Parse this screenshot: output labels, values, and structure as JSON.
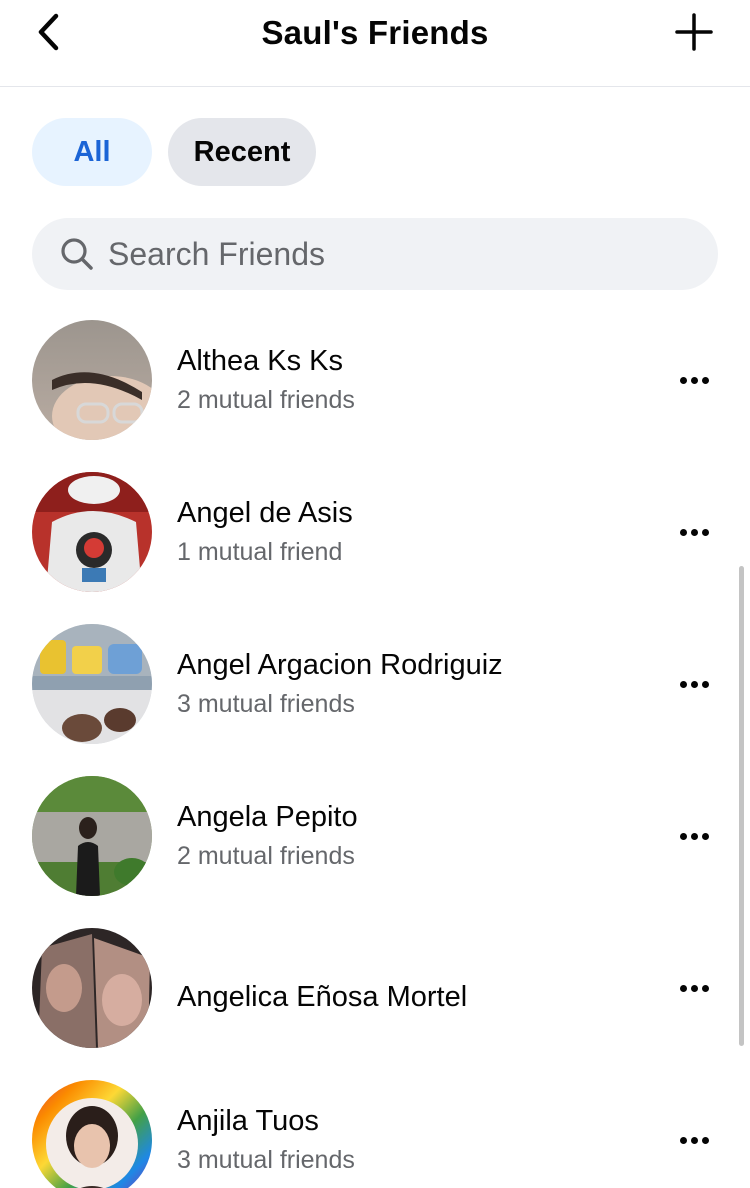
{
  "header": {
    "title": "Saul's Friends",
    "back_icon": "chevron-left-icon",
    "add_icon": "plus-icon"
  },
  "filters": {
    "all_label": "All",
    "recent_label": "Recent",
    "selected": "All"
  },
  "search": {
    "placeholder": "Search Friends",
    "icon": "search-icon"
  },
  "friends": [
    {
      "name": "Althea Ks Ks",
      "mutual": "2 mutual friends"
    },
    {
      "name": "Angel de Asis",
      "mutual": "1 mutual friend"
    },
    {
      "name": "Angel Argacion Rodriguiz",
      "mutual": "3 mutual friends"
    },
    {
      "name": "Angela Pepito",
      "mutual": "2 mutual friends"
    },
    {
      "name": "Angelica Eñosa Mortel",
      "mutual": ""
    },
    {
      "name": "Anjila Tuos",
      "mutual": "3 mutual friends"
    }
  ],
  "colors": {
    "accent_chip_bg": "#e7f3ff",
    "accent_text": "#1b64d6",
    "chip_bg": "#e4e6eb",
    "search_bg": "#f0f2f5",
    "secondary_text": "#65676b"
  }
}
